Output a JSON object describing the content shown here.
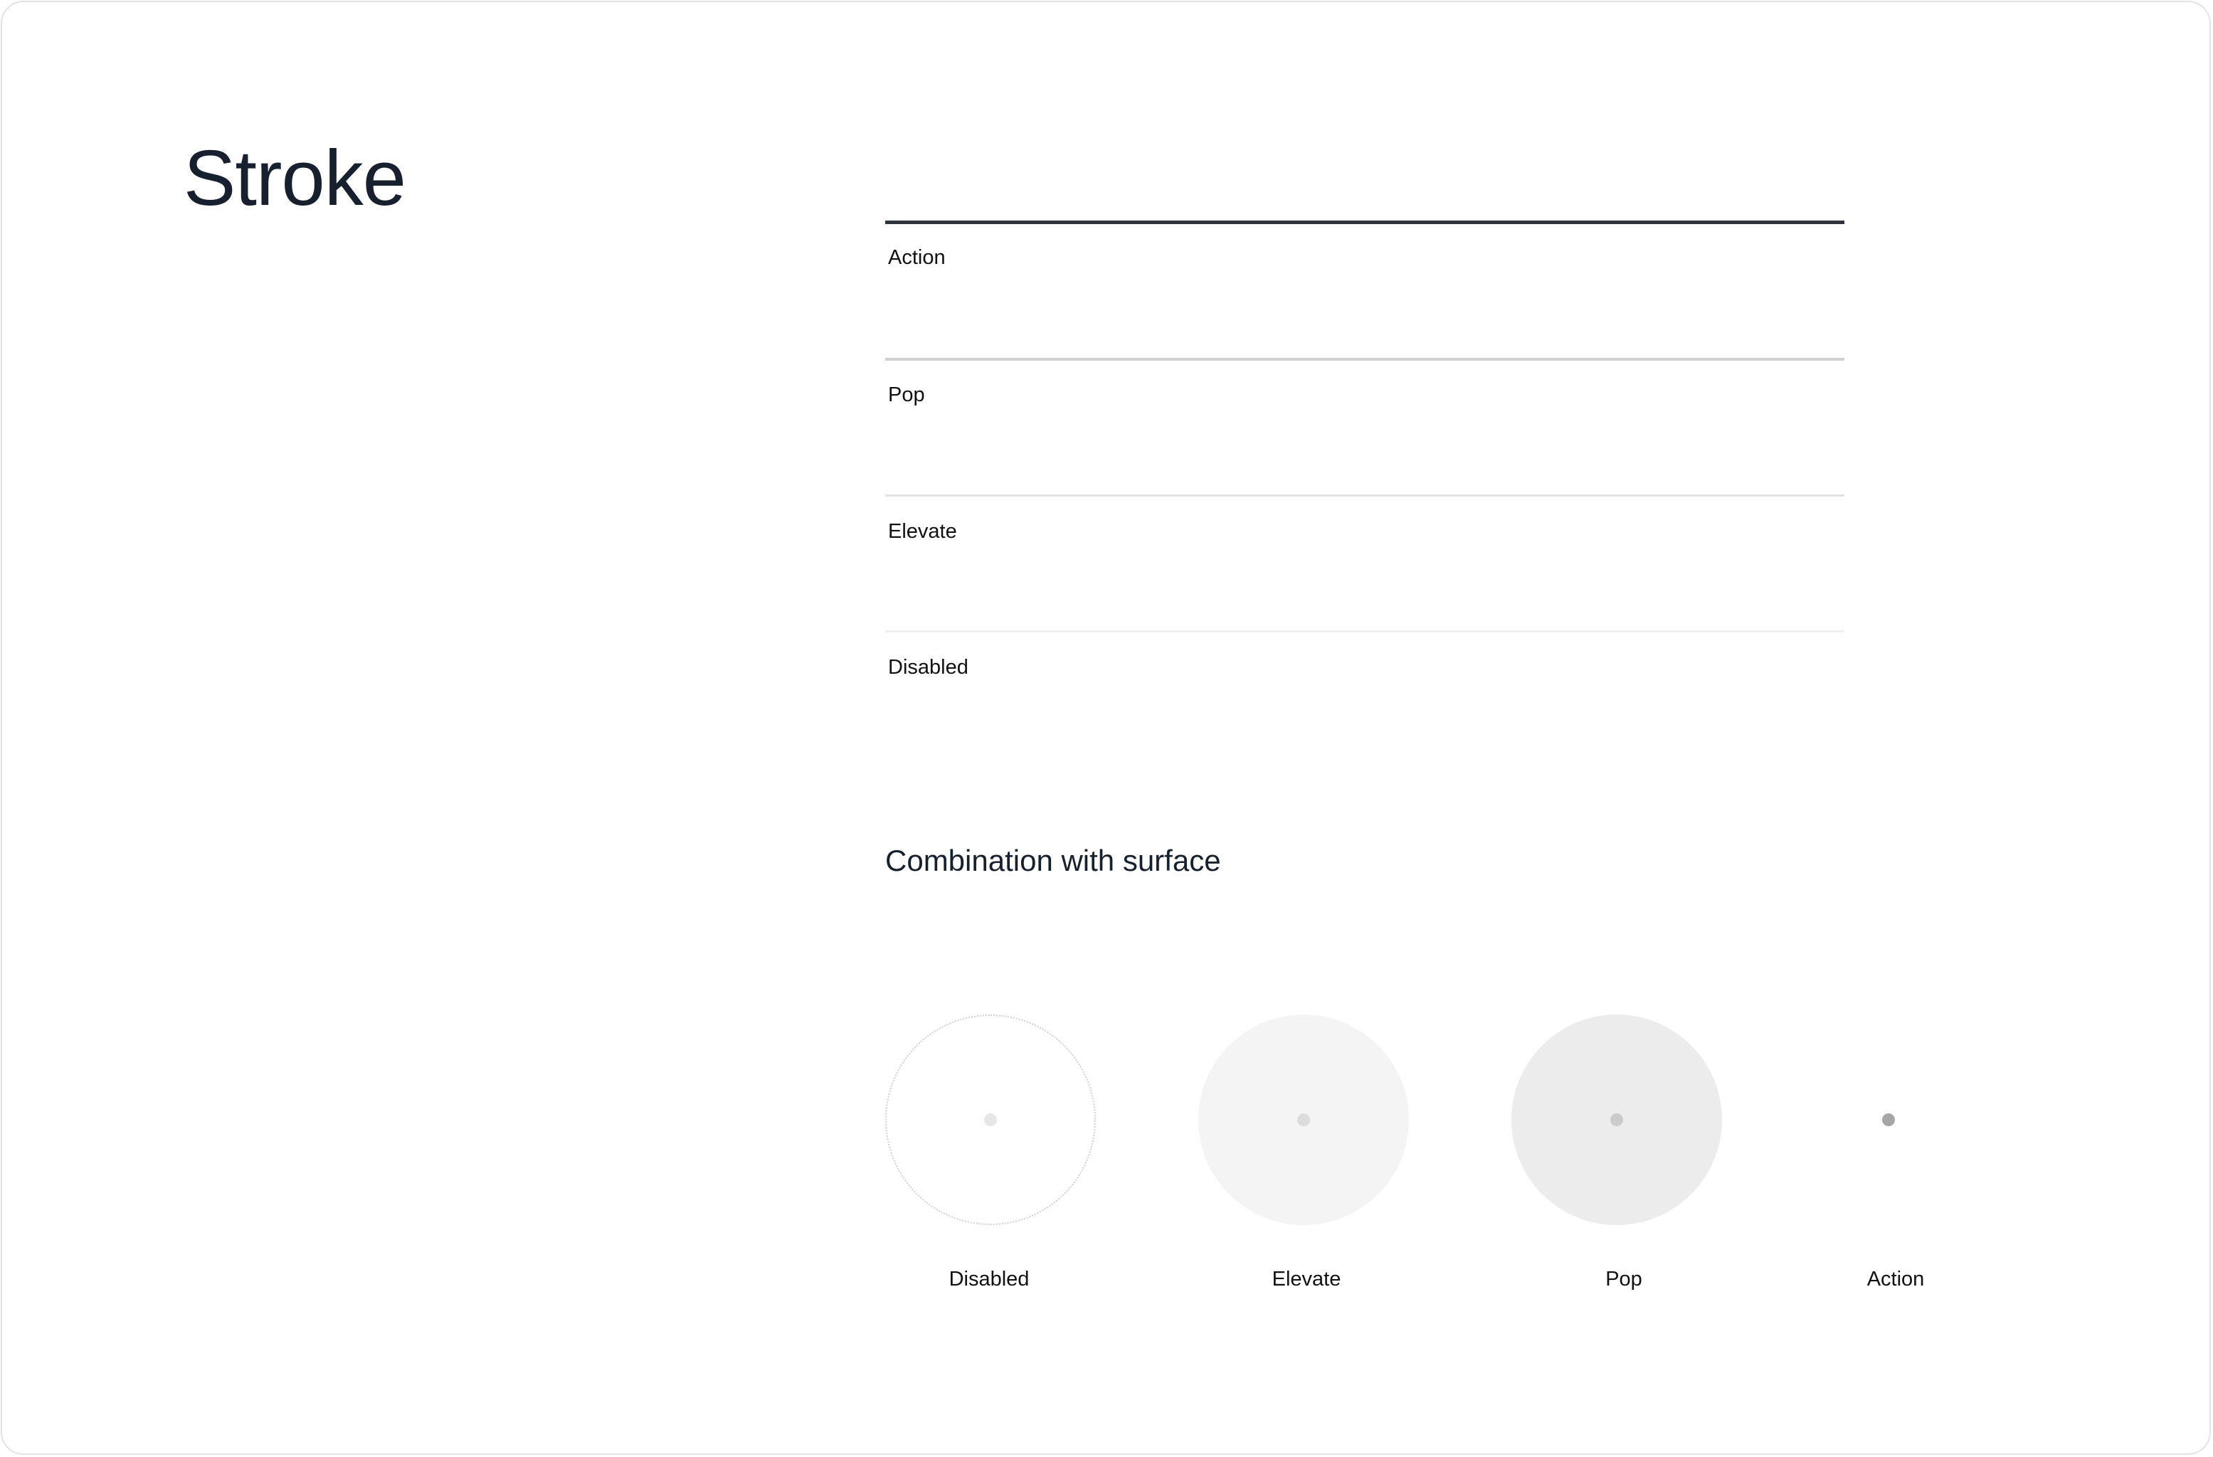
{
  "page": {
    "title": "Stroke"
  },
  "strokes": [
    {
      "label": "Action",
      "color": "#2f333b"
    },
    {
      "label": "Pop",
      "color": "#cfcfcf"
    },
    {
      "label": "Elevate",
      "color": "#e3e3e3"
    },
    {
      "label": "Disabled",
      "color": "#efefef"
    }
  ],
  "combination": {
    "heading": "Combination with surface",
    "items": [
      {
        "label": "Disabled",
        "surface": "#ffffff",
        "stroke": "#cfcfcf",
        "dot": "#e6e6e6"
      },
      {
        "label": "Elevate",
        "surface": "#f4f4f4",
        "stroke": "none",
        "dot": "#dcdcdc"
      },
      {
        "label": "Pop",
        "surface": "#ececec",
        "stroke": "none",
        "dot": "#cbcbcb"
      },
      {
        "label": "Action",
        "surface": "#ffffff",
        "stroke": "none",
        "dot": "#a6a6a6"
      }
    ]
  }
}
